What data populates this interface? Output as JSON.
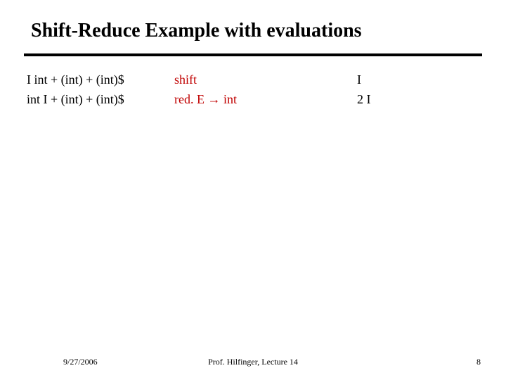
{
  "title": "Shift-Reduce Example with evaluations",
  "rows": [
    {
      "left": "I int + (int) + (int)$",
      "mid": "shift",
      "right": "I"
    },
    {
      "left": "int I + (int) + (int)$",
      "mid": "red. E → int",
      "right": "2 I"
    }
  ],
  "footer": {
    "date": "9/27/2006",
    "center": "Prof. Hilfinger, Lecture 14",
    "page": "8"
  }
}
